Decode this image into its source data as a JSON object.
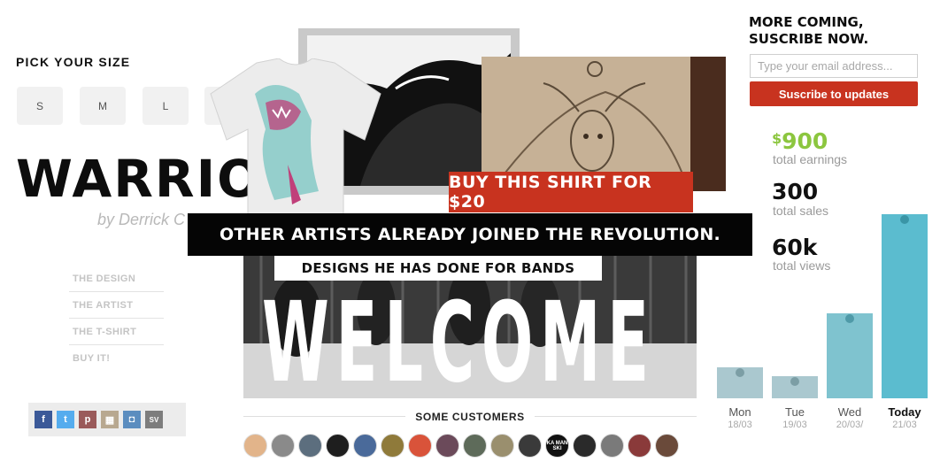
{
  "size_picker": {
    "title": "PICK YOUR SIZE",
    "sizes": [
      "S",
      "M",
      "L"
    ]
  },
  "product": {
    "title": "WARRIOR",
    "byline": "by Derrick C"
  },
  "nav": {
    "items": [
      "THE DESIGN",
      "THE ARTIST",
      "THE T-SHIRT",
      "BUY IT!"
    ]
  },
  "social": {
    "icons": [
      {
        "name": "facebook-icon",
        "glyph": "f",
        "color": "#3b5998"
      },
      {
        "name": "twitter-icon",
        "glyph": "t",
        "color": "#55acee"
      },
      {
        "name": "pinterest-icon",
        "glyph": "p",
        "color": "#9a5a5a"
      },
      {
        "name": "mosaic-icon",
        "glyph": "▦",
        "color": "#b8a890"
      },
      {
        "name": "notification-icon",
        "glyph": "◘",
        "color": "#5b8dbf"
      },
      {
        "name": "sv-icon",
        "glyph": "SV",
        "color": "#7d7d7d"
      }
    ]
  },
  "collage": {
    "buy_banner": "BUY THIS SHIRT FOR $20",
    "artists_banner": "OTHER ARTISTS ALREADY JOINED THE REVOLUTION.",
    "bands_banner": "DESIGNS HE HAS DONE FOR BANDS",
    "welcome": "WELCOME"
  },
  "customers": {
    "label": "SOME CUSTOMERS",
    "avatars": [
      {
        "color": "#e2b48a",
        "text": ""
      },
      {
        "color": "#8a8a8a",
        "text": ""
      },
      {
        "color": "#5c6e7e",
        "text": ""
      },
      {
        "color": "#1e1e1e",
        "text": ""
      },
      {
        "color": "#4a6a9a",
        "text": ""
      },
      {
        "color": "#8f7a3a",
        "text": ""
      },
      {
        "color": "#d9533a",
        "text": ""
      },
      {
        "color": "#6b4a5a",
        "text": ""
      },
      {
        "color": "#5e6b5a",
        "text": ""
      },
      {
        "color": "#9a8f6e",
        "text": ""
      },
      {
        "color": "#3a3a3a",
        "text": ""
      },
      {
        "color": "#111111",
        "text": "KA MAN SKI"
      },
      {
        "color": "#2a2a2a",
        "text": ""
      },
      {
        "color": "#7a7a7a",
        "text": ""
      },
      {
        "color": "#8a3a3a",
        "text": ""
      },
      {
        "color": "#6a4a3a",
        "text": ""
      }
    ]
  },
  "subscribe": {
    "title_line1": "MORE COMING,",
    "title_line2": "SUSCRIBE NOW.",
    "email_placeholder": "Type your email address...",
    "button_label": "Suscribe to updates"
  },
  "stats": {
    "earnings_value": "900",
    "earnings_currency": "$",
    "earnings_label": "total earnings",
    "sales_value": "300",
    "sales_label": "total sales",
    "views_value": "60k",
    "views_label": "total views"
  },
  "chart_data": {
    "type": "bar",
    "categories": [
      "Mon",
      "Tue",
      "Wed",
      "Today"
    ],
    "dates": [
      "18/03",
      "19/03",
      "20/03/",
      "21/03"
    ],
    "values": [
      17,
      12,
      46,
      100
    ],
    "ylim": [
      0,
      100
    ],
    "colors": [
      "#aac8cf",
      "#aac8cf",
      "#7fc3cf",
      "#5bbccf"
    ],
    "dot_colors": [
      "#7c9ea5",
      "#7c9ea5",
      "#4f9aa8",
      "#3a95a6"
    ],
    "grid": false
  }
}
